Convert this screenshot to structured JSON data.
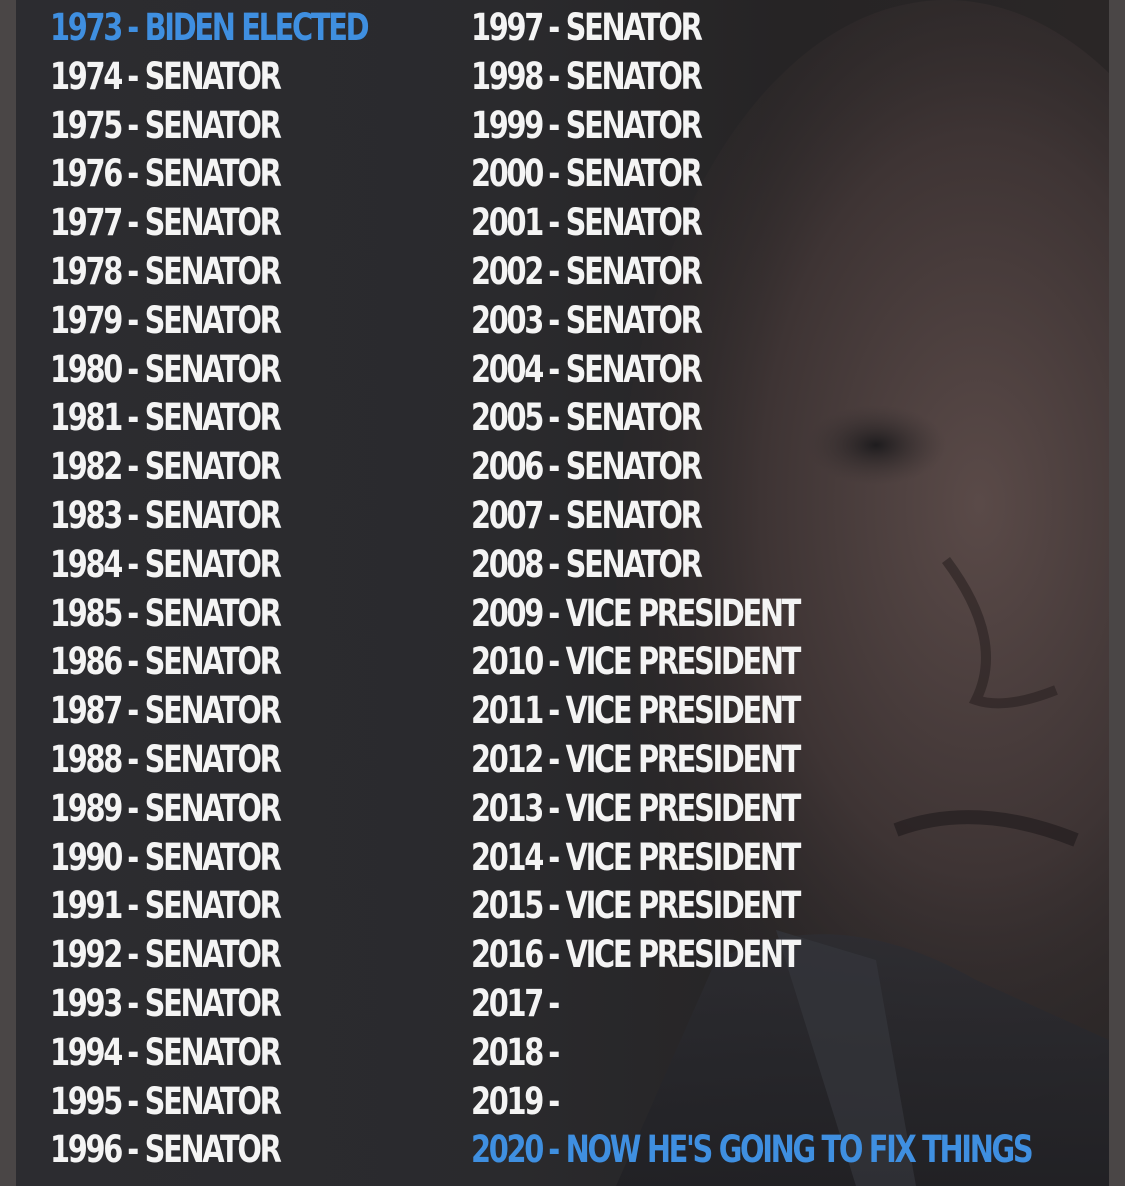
{
  "colors": {
    "text": "#f4f4f4",
    "highlight": "#3f8fe0",
    "background": "#2a2a2d"
  },
  "separator": "-",
  "left_column": [
    {
      "year": "1973",
      "role": "BIDEN ELECTED",
      "highlight": true
    },
    {
      "year": "1974",
      "role": "SENATOR"
    },
    {
      "year": "1975",
      "role": "SENATOR"
    },
    {
      "year": "1976",
      "role": "SENATOR"
    },
    {
      "year": "1977",
      "role": "SENATOR"
    },
    {
      "year": "1978",
      "role": "SENATOR"
    },
    {
      "year": "1979",
      "role": "SENATOR"
    },
    {
      "year": "1980",
      "role": "SENATOR"
    },
    {
      "year": "1981",
      "role": "SENATOR"
    },
    {
      "year": "1982",
      "role": "SENATOR"
    },
    {
      "year": "1983",
      "role": "SENATOR"
    },
    {
      "year": "1984",
      "role": "SENATOR"
    },
    {
      "year": "1985",
      "role": "SENATOR"
    },
    {
      "year": "1986",
      "role": "SENATOR"
    },
    {
      "year": "1987",
      "role": "SENATOR"
    },
    {
      "year": "1988",
      "role": "SENATOR"
    },
    {
      "year": "1989",
      "role": "SENATOR"
    },
    {
      "year": "1990",
      "role": "SENATOR"
    },
    {
      "year": "1991",
      "role": "SENATOR"
    },
    {
      "year": "1992",
      "role": "SENATOR"
    },
    {
      "year": "1993",
      "role": "SENATOR"
    },
    {
      "year": "1994",
      "role": "SENATOR"
    },
    {
      "year": "1995",
      "role": "SENATOR"
    },
    {
      "year": "1996",
      "role": "SENATOR"
    }
  ],
  "right_column": [
    {
      "year": "1997",
      "role": "SENATOR"
    },
    {
      "year": "1998",
      "role": "SENATOR"
    },
    {
      "year": "1999",
      "role": "SENATOR"
    },
    {
      "year": "2000",
      "role": "SENATOR"
    },
    {
      "year": "2001",
      "role": "SENATOR"
    },
    {
      "year": "2002",
      "role": "SENATOR"
    },
    {
      "year": "2003",
      "role": "SENATOR"
    },
    {
      "year": "2004",
      "role": "SENATOR"
    },
    {
      "year": "2005",
      "role": "SENATOR"
    },
    {
      "year": "2006",
      "role": "SENATOR"
    },
    {
      "year": "2007",
      "role": "SENATOR"
    },
    {
      "year": "2008",
      "role": "SENATOR"
    },
    {
      "year": "2009",
      "role": "VICE PRESIDENT"
    },
    {
      "year": "2010",
      "role": "VICE PRESIDENT"
    },
    {
      "year": "2011",
      "role": "VICE PRESIDENT"
    },
    {
      "year": "2012",
      "role": "VICE PRESIDENT"
    },
    {
      "year": "2013",
      "role": "VICE PRESIDENT"
    },
    {
      "year": "2014",
      "role": "VICE PRESIDENT"
    },
    {
      "year": "2015",
      "role": "VICE PRESIDENT"
    },
    {
      "year": "2016",
      "role": "VICE PRESIDENT"
    },
    {
      "year": "2017",
      "role": ""
    },
    {
      "year": "2018",
      "role": ""
    },
    {
      "year": "2019",
      "role": ""
    },
    {
      "year": "2020",
      "role": "NOW HE'S GOING TO FIX THINGS",
      "highlight": true
    }
  ]
}
